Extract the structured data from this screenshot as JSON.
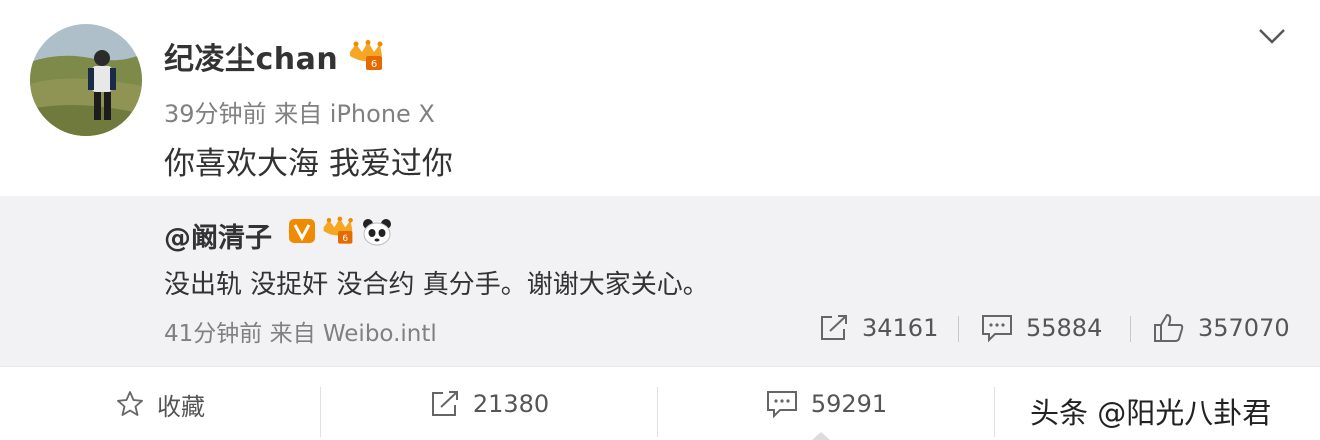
{
  "post": {
    "username": "纪凌尘chan",
    "meta": "39分钟前 来自 iPhone X",
    "text": "你喜欢大海 我爱过你"
  },
  "repost": {
    "username": "@阚清子",
    "text": "没出轨 没捉奸 没合约 真分手。谢谢大家关心。",
    "meta": "41分钟前 来自 Weibo.intl",
    "stats": {
      "reposts": "34161",
      "comments": "55884",
      "likes": "357070"
    }
  },
  "actions": {
    "favorite_label": "收藏",
    "reposts": "21380",
    "comments": "59291"
  },
  "watermark": "头条 @阳光八卦君",
  "icons": [
    "user-avatar",
    "vip-crown-badge",
    "chevron-down-icon",
    "verified-v-icon",
    "panda-icon",
    "repost-icon",
    "comment-icon",
    "like-icon",
    "star-icon"
  ],
  "colors": {
    "vip_orange": "#f5a623",
    "verified_orange": "#f08a00",
    "repost_bg": "#f2f2f5",
    "meta_gray": "#808080"
  }
}
